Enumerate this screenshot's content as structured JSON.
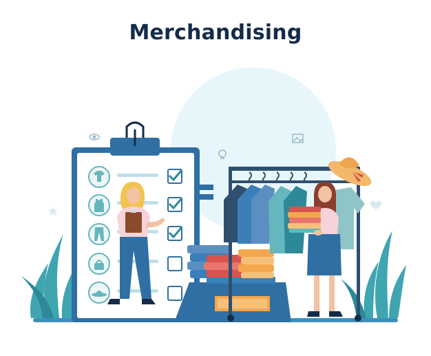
{
  "header": {
    "title": "Merchandising"
  },
  "checklist": {
    "items": [
      {
        "icon": "tshirt-icon",
        "checked": true
      },
      {
        "icon": "tank-top-icon",
        "checked": true
      },
      {
        "icon": "pants-icon",
        "checked": true
      },
      {
        "icon": "handbag-icon",
        "checked": false
      },
      {
        "icon": "hat-icon",
        "checked": false
      }
    ]
  },
  "colors": {
    "title": "#142c4a",
    "primary_blue": "#2f6fa3",
    "light_blue_bg": "#e7f6fb",
    "teal": "#63b7bd",
    "red": "#d9534f",
    "orange": "#f3a84d",
    "skin": "#f2c2a2"
  }
}
